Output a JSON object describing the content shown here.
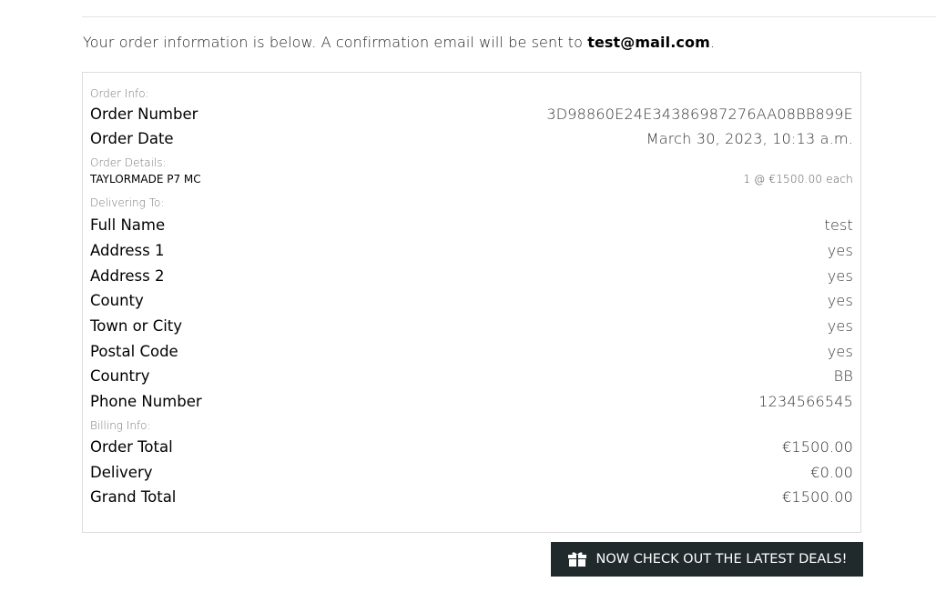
{
  "intro": {
    "text": "Your order information is below. A confirmation email will be sent to ",
    "email": "test@mail.com",
    "end": "."
  },
  "order_info": {
    "label": "Order Info:",
    "order_number_label": "Order Number",
    "order_number": "3D98860E24E34386987276AA08BB899E",
    "order_date_label": "Order Date",
    "order_date": "March 30, 2023, 10:13 a.m."
  },
  "order_details": {
    "label": "Order Details:",
    "items": [
      {
        "name": "TaylorMade P7 MC",
        "qty_price": "1 @ €1500.00 each"
      }
    ]
  },
  "delivering_to": {
    "label": "Delivering To:",
    "fields": [
      {
        "label": "Full Name",
        "value": "test"
      },
      {
        "label": "Address 1",
        "value": "yes"
      },
      {
        "label": "Address 2",
        "value": "yes"
      },
      {
        "label": "County",
        "value": "yes"
      },
      {
        "label": "Town or City",
        "value": "yes"
      },
      {
        "label": "Postal Code",
        "value": "yes"
      },
      {
        "label": "Country",
        "value": "BB"
      },
      {
        "label": "Phone Number",
        "value": "1234566545"
      }
    ]
  },
  "billing_info": {
    "label": "Billing Info:",
    "fields": [
      {
        "label": "Order Total",
        "value": "€1500.00"
      },
      {
        "label": "Delivery",
        "value": "€0.00"
      },
      {
        "label": "Grand Total",
        "value": "€1500.00"
      }
    ]
  },
  "cta": {
    "label": "Now check out the latest deals!",
    "icon": "gift-icon",
    "background": "#20292c"
  }
}
